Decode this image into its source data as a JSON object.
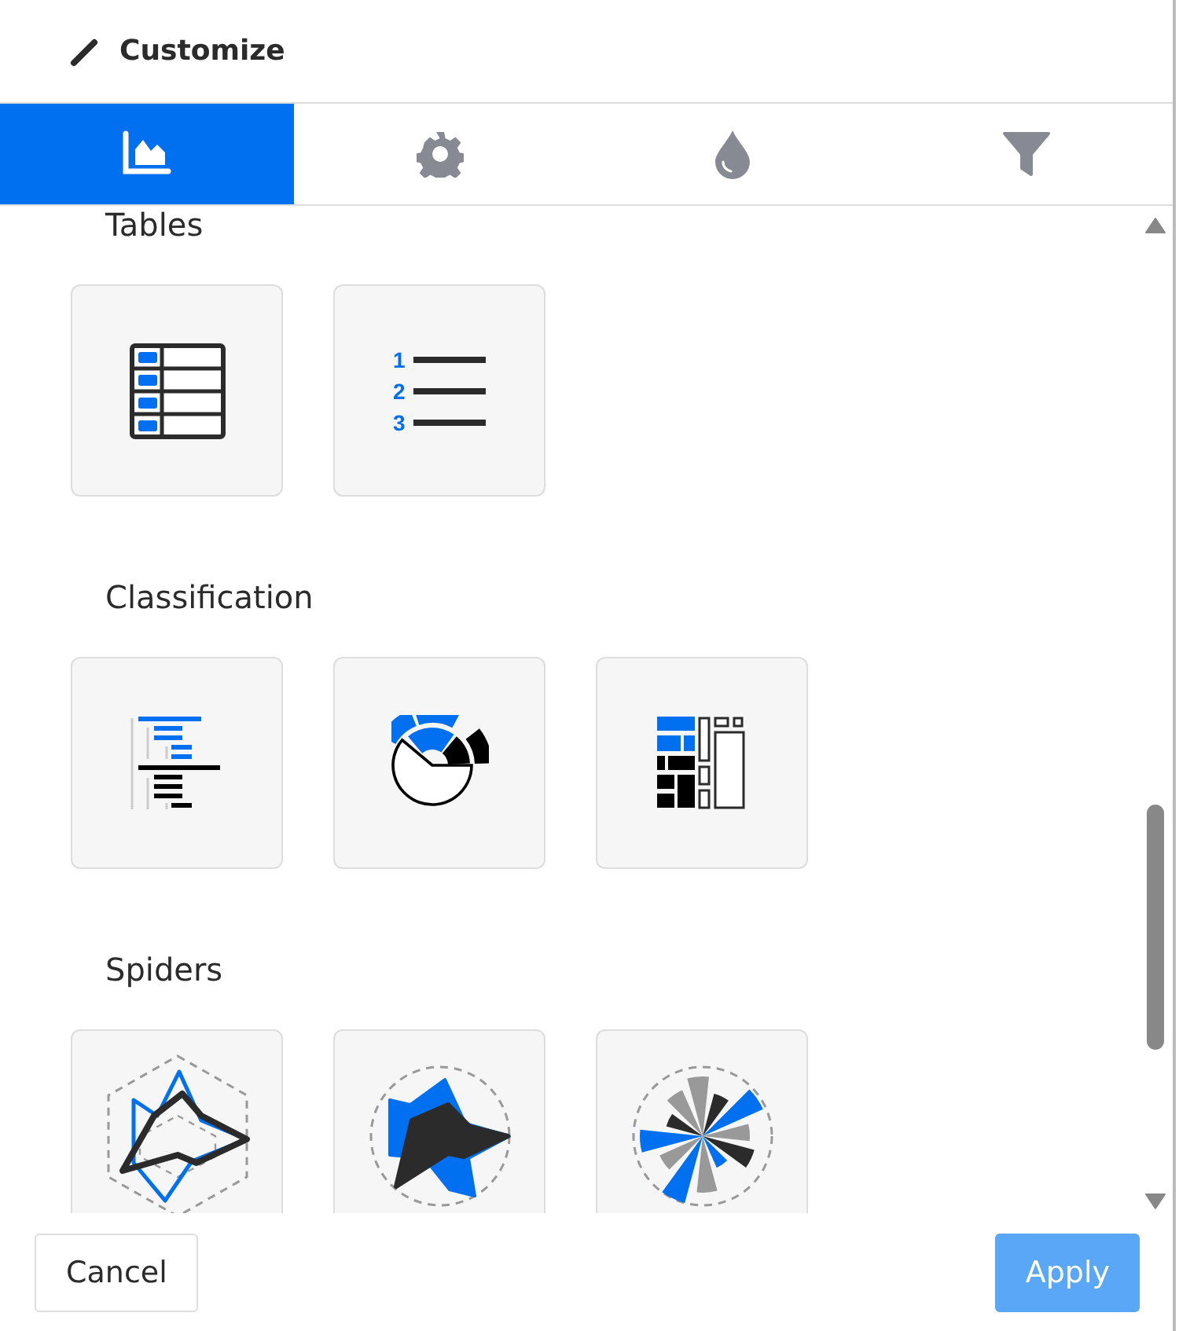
{
  "header": {
    "title": "Customize"
  },
  "tabs": [
    {
      "kind": "chart",
      "selected": true
    },
    {
      "kind": "settings",
      "selected": false
    },
    {
      "kind": "color",
      "selected": false
    },
    {
      "kind": "filter",
      "selected": false
    }
  ],
  "sections": [
    {
      "title": "Tables",
      "tiles": [
        {
          "kind": "table"
        },
        {
          "kind": "numbered-list",
          "numbers": [
            "1",
            "2",
            "3"
          ]
        }
      ]
    },
    {
      "title": "Classification",
      "tiles": [
        {
          "kind": "tree-bars"
        },
        {
          "kind": "sunburst"
        },
        {
          "kind": "treemap"
        }
      ]
    },
    {
      "title": "Spiders",
      "tiles": [
        {
          "kind": "radar-lines"
        },
        {
          "kind": "radar-filled"
        },
        {
          "kind": "polar-rose"
        }
      ]
    }
  ],
  "buttons": [
    {
      "kind": "secondary",
      "label": "Cancel"
    },
    {
      "kind": "primary",
      "label": "Apply"
    }
  ]
}
